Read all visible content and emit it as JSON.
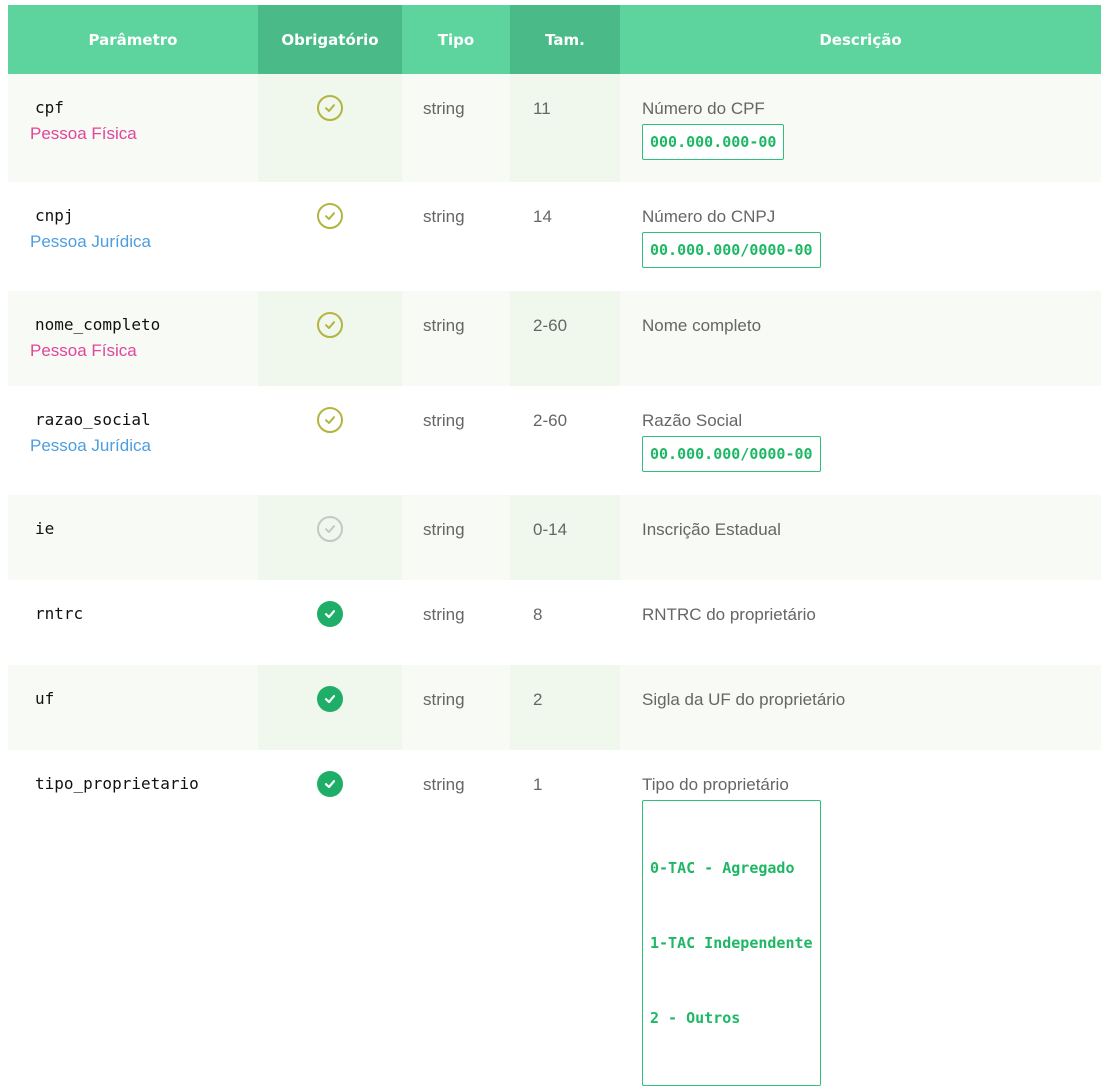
{
  "table": {
    "headers": {
      "param": "Parâmetro",
      "required": "Obrigatório",
      "type": "Tipo",
      "size": "Tam.",
      "description": "Descrição"
    },
    "rows": [
      {
        "name": "cpf",
        "tag": "Pessoa Física",
        "required_icon": "check-circle-outline-icon",
        "type": "string",
        "size": "11",
        "description": "Número do CPF",
        "code": "000.000.000-00"
      },
      {
        "name": "cnpj",
        "tag": "Pessoa Jurídica",
        "required_icon": "check-circle-outline-icon",
        "type": "string",
        "size": "14",
        "description": "Número do CNPJ",
        "code": "00.000.000/0000-00"
      },
      {
        "name": "nome_completo",
        "tag": "Pessoa Física",
        "required_icon": "check-circle-outline-icon",
        "type": "string",
        "size": "2-60",
        "description": "Nome completo"
      },
      {
        "name": "razao_social",
        "tag": "Pessoa Jurídica",
        "required_icon": "check-circle-outline-icon",
        "type": "string",
        "size": "2-60",
        "description": "Razão Social",
        "code": "00.000.000/0000-00"
      },
      {
        "name": "ie",
        "required_icon": "check-circle-gray-icon",
        "type": "string",
        "size": "0-14",
        "description": "Inscrição Estadual"
      },
      {
        "name": "rntrc",
        "required_icon": "check-circle-filled-icon",
        "type": "string",
        "size": "8",
        "description": "RNTRC do proprietário"
      },
      {
        "name": "uf",
        "required_icon": "check-circle-filled-icon",
        "type": "string",
        "size": "2",
        "description": "Sigla da UF do proprietário"
      },
      {
        "name": "tipo_proprietario",
        "required_icon": "check-circle-filled-icon",
        "type": "string",
        "size": "1",
        "description": "Tipo do proprietário",
        "code_lines": [
          "0-TAC - Agregado",
          "1-TAC Independente",
          "2 - Outros"
        ]
      }
    ]
  },
  "colors": {
    "header": "#5dd39e",
    "header_dark": "#4aba88",
    "pessoa_fisica": "#e0469b",
    "pessoa_juridica": "#4d9ee0",
    "check_outline": "#b3b442",
    "check_filled": "#1fae68",
    "code": "#1eb765"
  }
}
